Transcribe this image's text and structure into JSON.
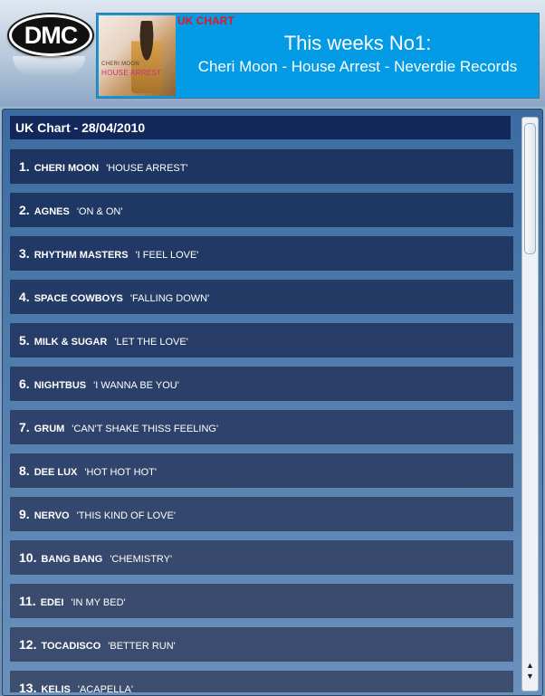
{
  "header": {
    "logo_text": "DMC",
    "banner_label": "UK CHART",
    "headline": "This weeks No1:",
    "subline": "Cheri Moon - House Arrest - Neverdie Records",
    "cover": {
      "artist": "CHERI MOON",
      "title": "HOUSE ARREST"
    }
  },
  "chart": {
    "title": "UK Chart - 28/04/2010",
    "rows": [
      {
        "rank": "1.",
        "artist": "CHERI MOON",
        "title": "'HOUSE ARREST'"
      },
      {
        "rank": "2.",
        "artist": "AGNES",
        "title": "'ON & ON'"
      },
      {
        "rank": "3.",
        "artist": "RHYTHM MASTERS",
        "title": "'I FEEL LOVE'"
      },
      {
        "rank": "4.",
        "artist": "SPACE COWBOYS",
        "title": "'FALLING DOWN'"
      },
      {
        "rank": "5.",
        "artist": "MILK & SUGAR",
        "title": "'LET THE LOVE'"
      },
      {
        "rank": "6.",
        "artist": "NIGHTBUS",
        "title": "'I WANNA BE YOU'"
      },
      {
        "rank": "7.",
        "artist": "GRUM",
        "title": "'CAN'T SHAKE THISS FEELING'"
      },
      {
        "rank": "8.",
        "artist": "DEE LUX",
        "title": "'HOT HOT HOT'"
      },
      {
        "rank": "9.",
        "artist": "NERVO",
        "title": "'THIS KIND OF LOVE'"
      },
      {
        "rank": "10.",
        "artist": "BANG BANG",
        "title": "'CHEMISTRY'"
      },
      {
        "rank": "11.",
        "artist": "EDEI",
        "title": "'IN MY BED'"
      },
      {
        "rank": "12.",
        "artist": "TOCADISCO",
        "title": "'BETTER RUN'"
      },
      {
        "rank": "13.",
        "artist": "KELIS",
        "title": "'ACAPELLA'"
      }
    ],
    "row_colors": [
      "#1e3561",
      "#1f3763",
      "#223965",
      "#243b66",
      "#273d68",
      "#2b4069",
      "#2e426b",
      "#31456c",
      "#34476d",
      "#37496d",
      "#3a4b6e",
      "#3c4c6e",
      "#3e4e6f"
    ]
  },
  "scrollbar": {
    "up_icon": "scroll-up-arrow",
    "down_icon": "scroll-down-arrow"
  }
}
